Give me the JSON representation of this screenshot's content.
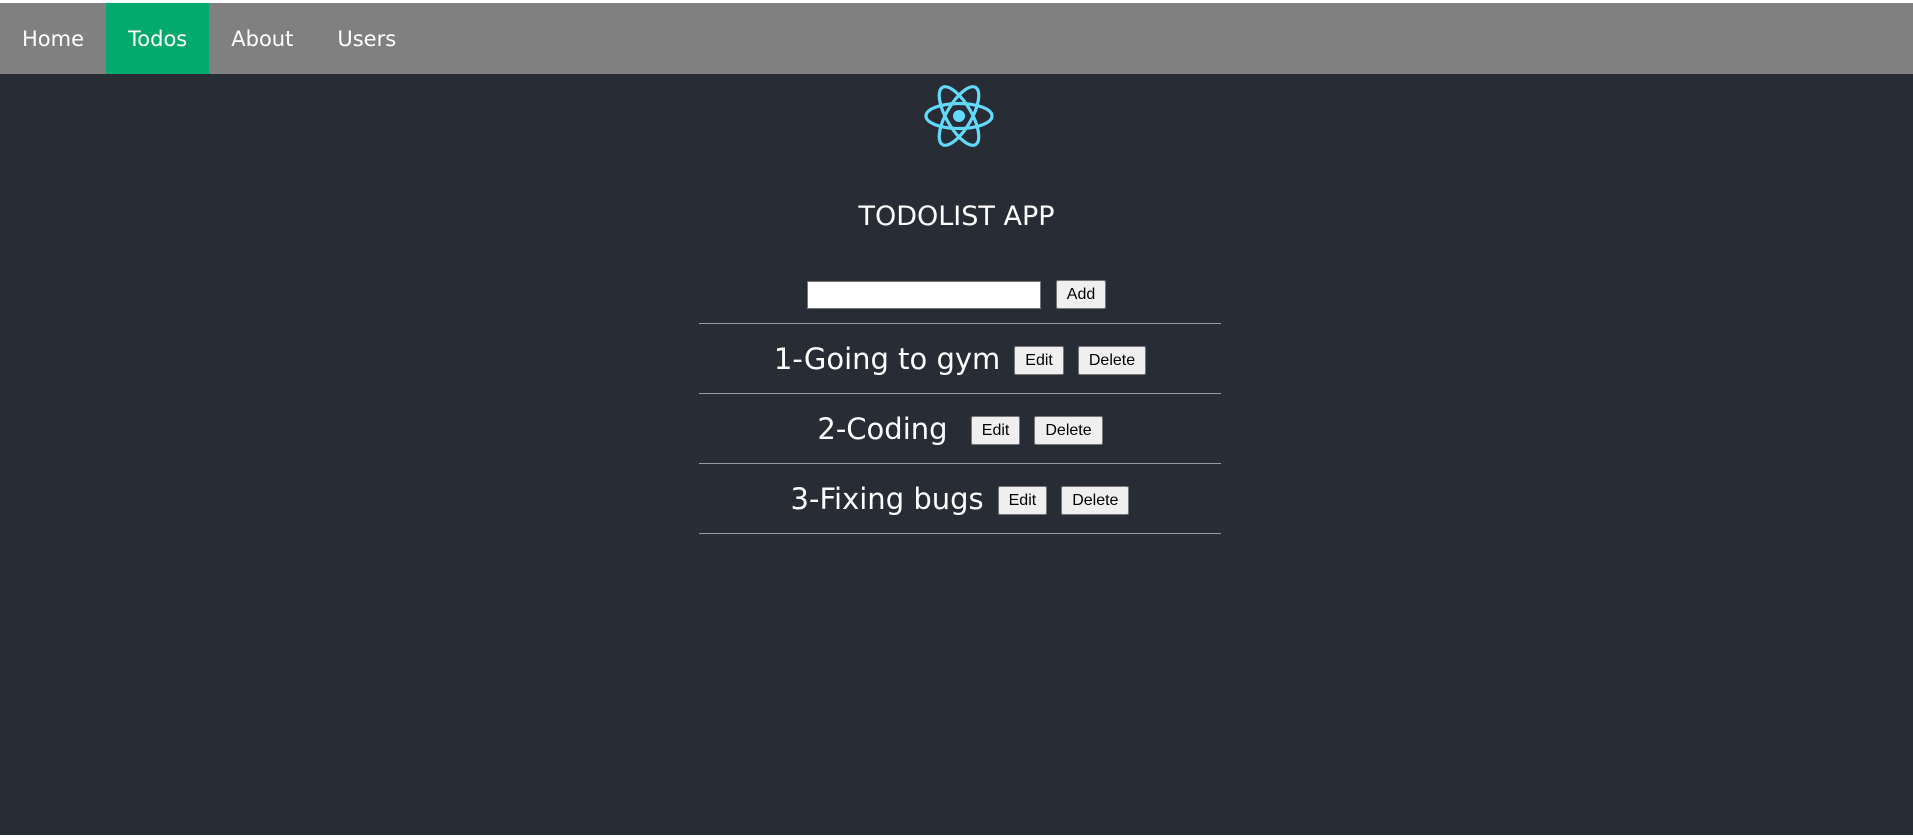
{
  "nav": {
    "items": [
      {
        "label": "Home",
        "active": false
      },
      {
        "label": "Todos",
        "active": true
      },
      {
        "label": "About",
        "active": false
      },
      {
        "label": "Users",
        "active": false
      }
    ]
  },
  "colors": {
    "background": "#282c34",
    "navbar": "#808080",
    "nav_active": "#04aa6d",
    "logo": "#61dafb",
    "text": "#ffffff"
  },
  "logo": {
    "icon": "react-logo-icon"
  },
  "title": "TODOLIST APP",
  "add_form": {
    "input_value": "",
    "add_label": "Add"
  },
  "todos": [
    {
      "text": "1-Going to gym",
      "edit_label": "Edit",
      "delete_label": "Delete"
    },
    {
      "text": "2-Coding ",
      "edit_label": "Edit",
      "delete_label": "Delete"
    },
    {
      "text": "3-Fixing bugs",
      "edit_label": "Edit",
      "delete_label": "Delete"
    }
  ]
}
